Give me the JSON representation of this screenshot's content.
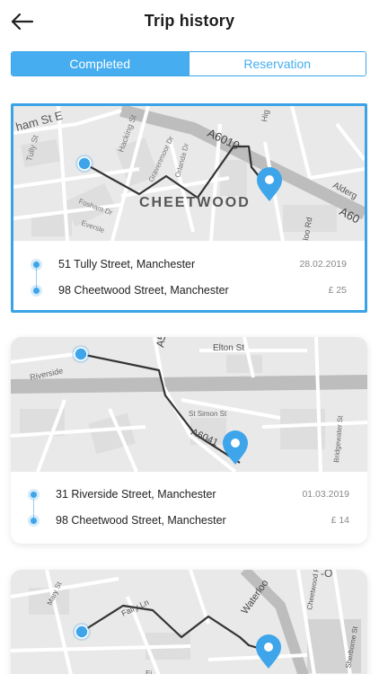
{
  "header": {
    "title": "Trip history",
    "back_icon": "arrow-left-icon"
  },
  "tabs": [
    {
      "label": "Completed",
      "active": true
    },
    {
      "label": "Reservation",
      "active": false
    }
  ],
  "colors": {
    "accent": "#46aef0",
    "route_line": "#333333",
    "map_bg": "#e8e8e8",
    "road": "#bdbdbd"
  },
  "trips": [
    {
      "map_labels": {
        "a": "Tully St",
        "b": "ham St E",
        "c": "Hacking St",
        "d": "Gravenmoor Dr",
        "e": "Orlanda Dr",
        "f": "A6010",
        "g": "Alderg",
        "h": "A60",
        "i": "CHEETWOOD",
        "j": "Fosham Dr",
        "k": "Eversle",
        "l": "loo Rd",
        "m": "Hig"
      },
      "from": "51 Tully Street, Manchester",
      "to": "98 Cheetwood Street, Manchester",
      "date": "28.02.2019",
      "price": "£ 25"
    },
    {
      "map_labels": {
        "a": "Elton St",
        "b": "Riverside",
        "c": "St Simon St",
        "d": "A6041",
        "e": "Bridgewater St",
        "f": "A5"
      },
      "from": "31 Riverside Street, Manchester",
      "to": "98 Cheetwood Street, Manchester",
      "date": "01.03.2019",
      "price": "£ 14"
    },
    {
      "map_labels": {
        "a": "Fairy Ln",
        "b": "Waterloo",
        "c": "Cheetwood Rd",
        "d": "Sherborne St",
        "e": "Mary St",
        "f": "Ei",
        "g": "-O"
      }
    }
  ]
}
